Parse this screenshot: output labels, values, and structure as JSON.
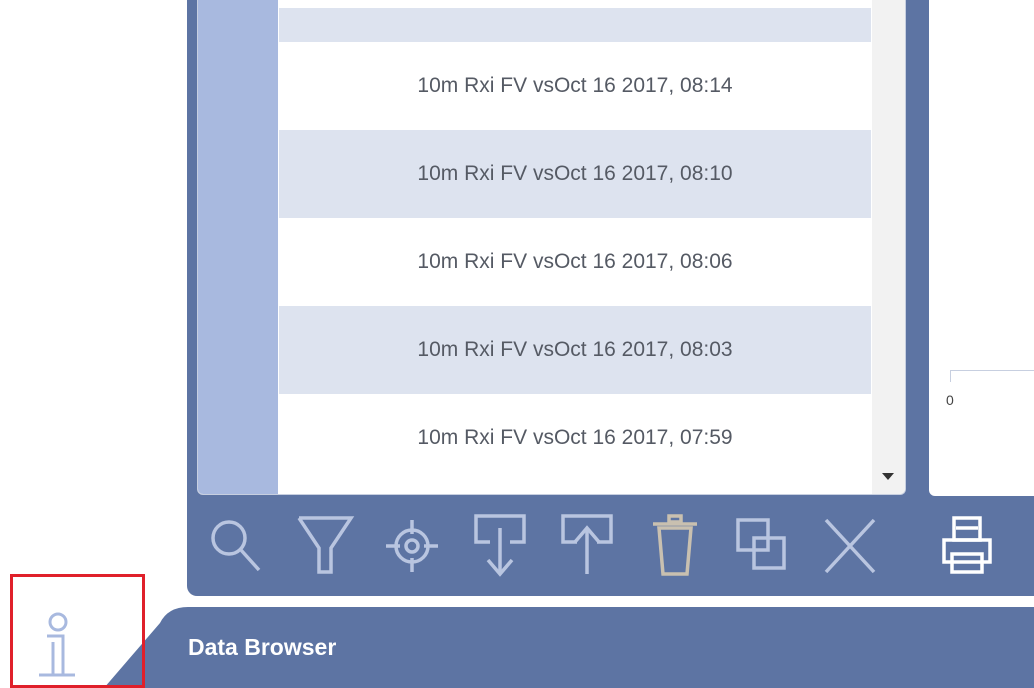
{
  "data_list": {
    "rows": [
      "10m Rxi FV vsOct 16 2017, 08:14",
      "10m Rxi FV vsOct 16 2017, 08:10",
      "10m Rxi FV vsOct 16 2017, 08:06",
      "10m Rxi FV vsOct 16 2017, 08:03",
      "10m Rxi FV vsOct 16 2017, 07:59"
    ]
  },
  "chart": {
    "tick_label": "0"
  },
  "toolbar": {
    "icons": [
      "search-icon",
      "filter-icon",
      "target-icon",
      "import-icon",
      "export-icon",
      "trash-icon",
      "copy-icon",
      "close-icon",
      "print-icon"
    ]
  },
  "bottom_bar": {
    "title": "Data Browser"
  },
  "colors": {
    "panel": "#5d74a3",
    "row_alt": "#dde3ef",
    "sidebar": "#a8b9df",
    "icon_stroke": "#b9c5e0",
    "highlight": "#e0202a"
  }
}
